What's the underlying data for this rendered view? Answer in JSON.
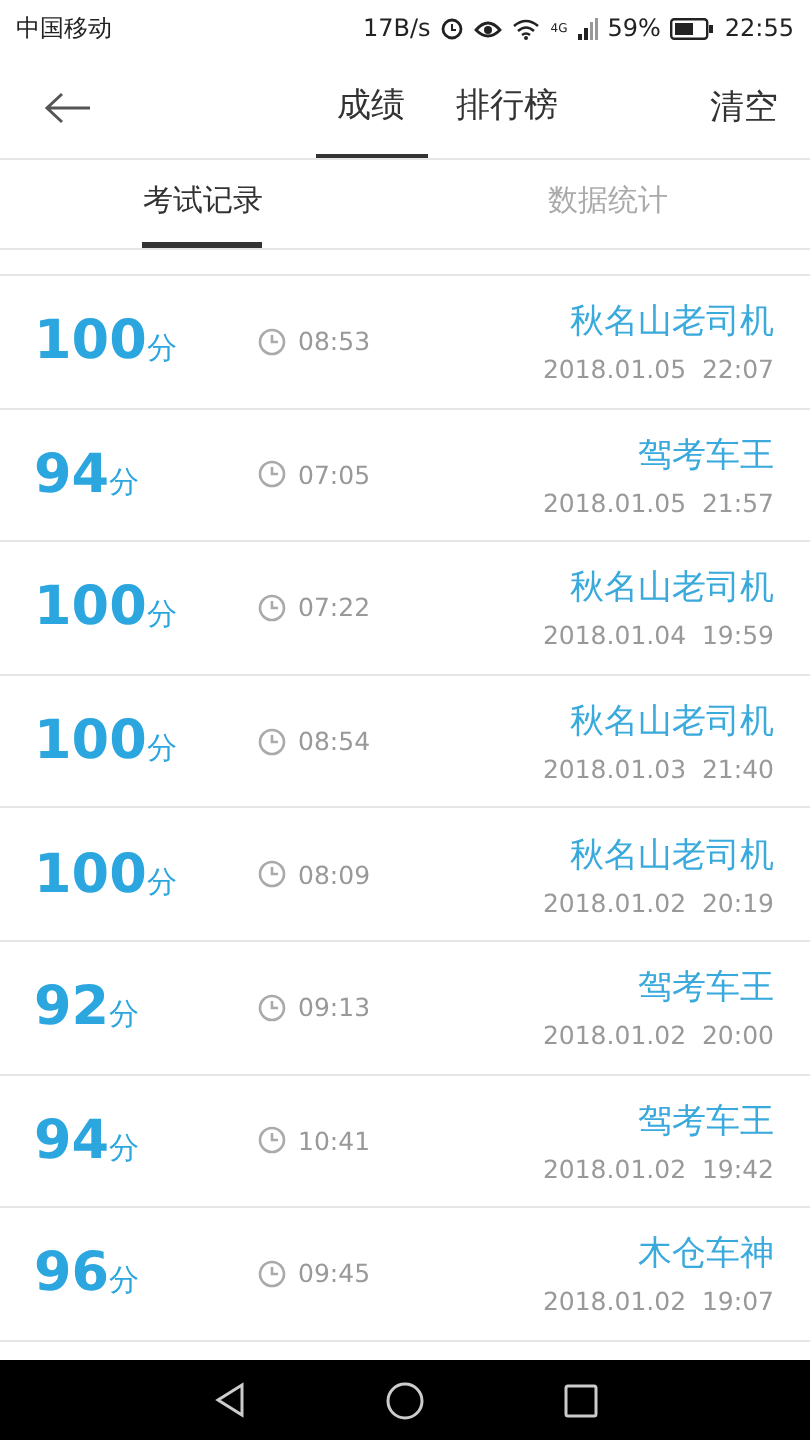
{
  "status_bar": {
    "carrier": "中国移动",
    "speed": "17B/s",
    "network": "4G",
    "battery": "59%",
    "time": "22:55"
  },
  "nav": {
    "tabs": [
      {
        "label": "成绩",
        "selected": true
      },
      {
        "label": "排行榜",
        "selected": false
      }
    ],
    "action": "清空"
  },
  "sub_tabs": [
    {
      "label": "考试记录",
      "selected": true
    },
    {
      "label": "数据统计",
      "selected": false
    }
  ],
  "records": [
    {
      "score": "100",
      "unit": "分",
      "duration": "08:53",
      "title": "秋名山老司机",
      "date": "2018.01.05  22:07"
    },
    {
      "score": "94",
      "unit": "分",
      "duration": "07:05",
      "title": "驾考车王",
      "date": "2018.01.05  21:57"
    },
    {
      "score": "100",
      "unit": "分",
      "duration": "07:22",
      "title": "秋名山老司机",
      "date": "2018.01.04  19:59"
    },
    {
      "score": "100",
      "unit": "分",
      "duration": "08:54",
      "title": "秋名山老司机",
      "date": "2018.01.03  21:40"
    },
    {
      "score": "100",
      "unit": "分",
      "duration": "08:09",
      "title": "秋名山老司机",
      "date": "2018.01.02  20:19"
    },
    {
      "score": "92",
      "unit": "分",
      "duration": "09:13",
      "title": "驾考车王",
      "date": "2018.01.02  20:00"
    },
    {
      "score": "94",
      "unit": "分",
      "duration": "10:41",
      "title": "驾考车王",
      "date": "2018.01.02  19:42"
    },
    {
      "score": "96",
      "unit": "分",
      "duration": "09:45",
      "title": "木仓车神",
      "date": "2018.01.02  19:07"
    }
  ]
}
